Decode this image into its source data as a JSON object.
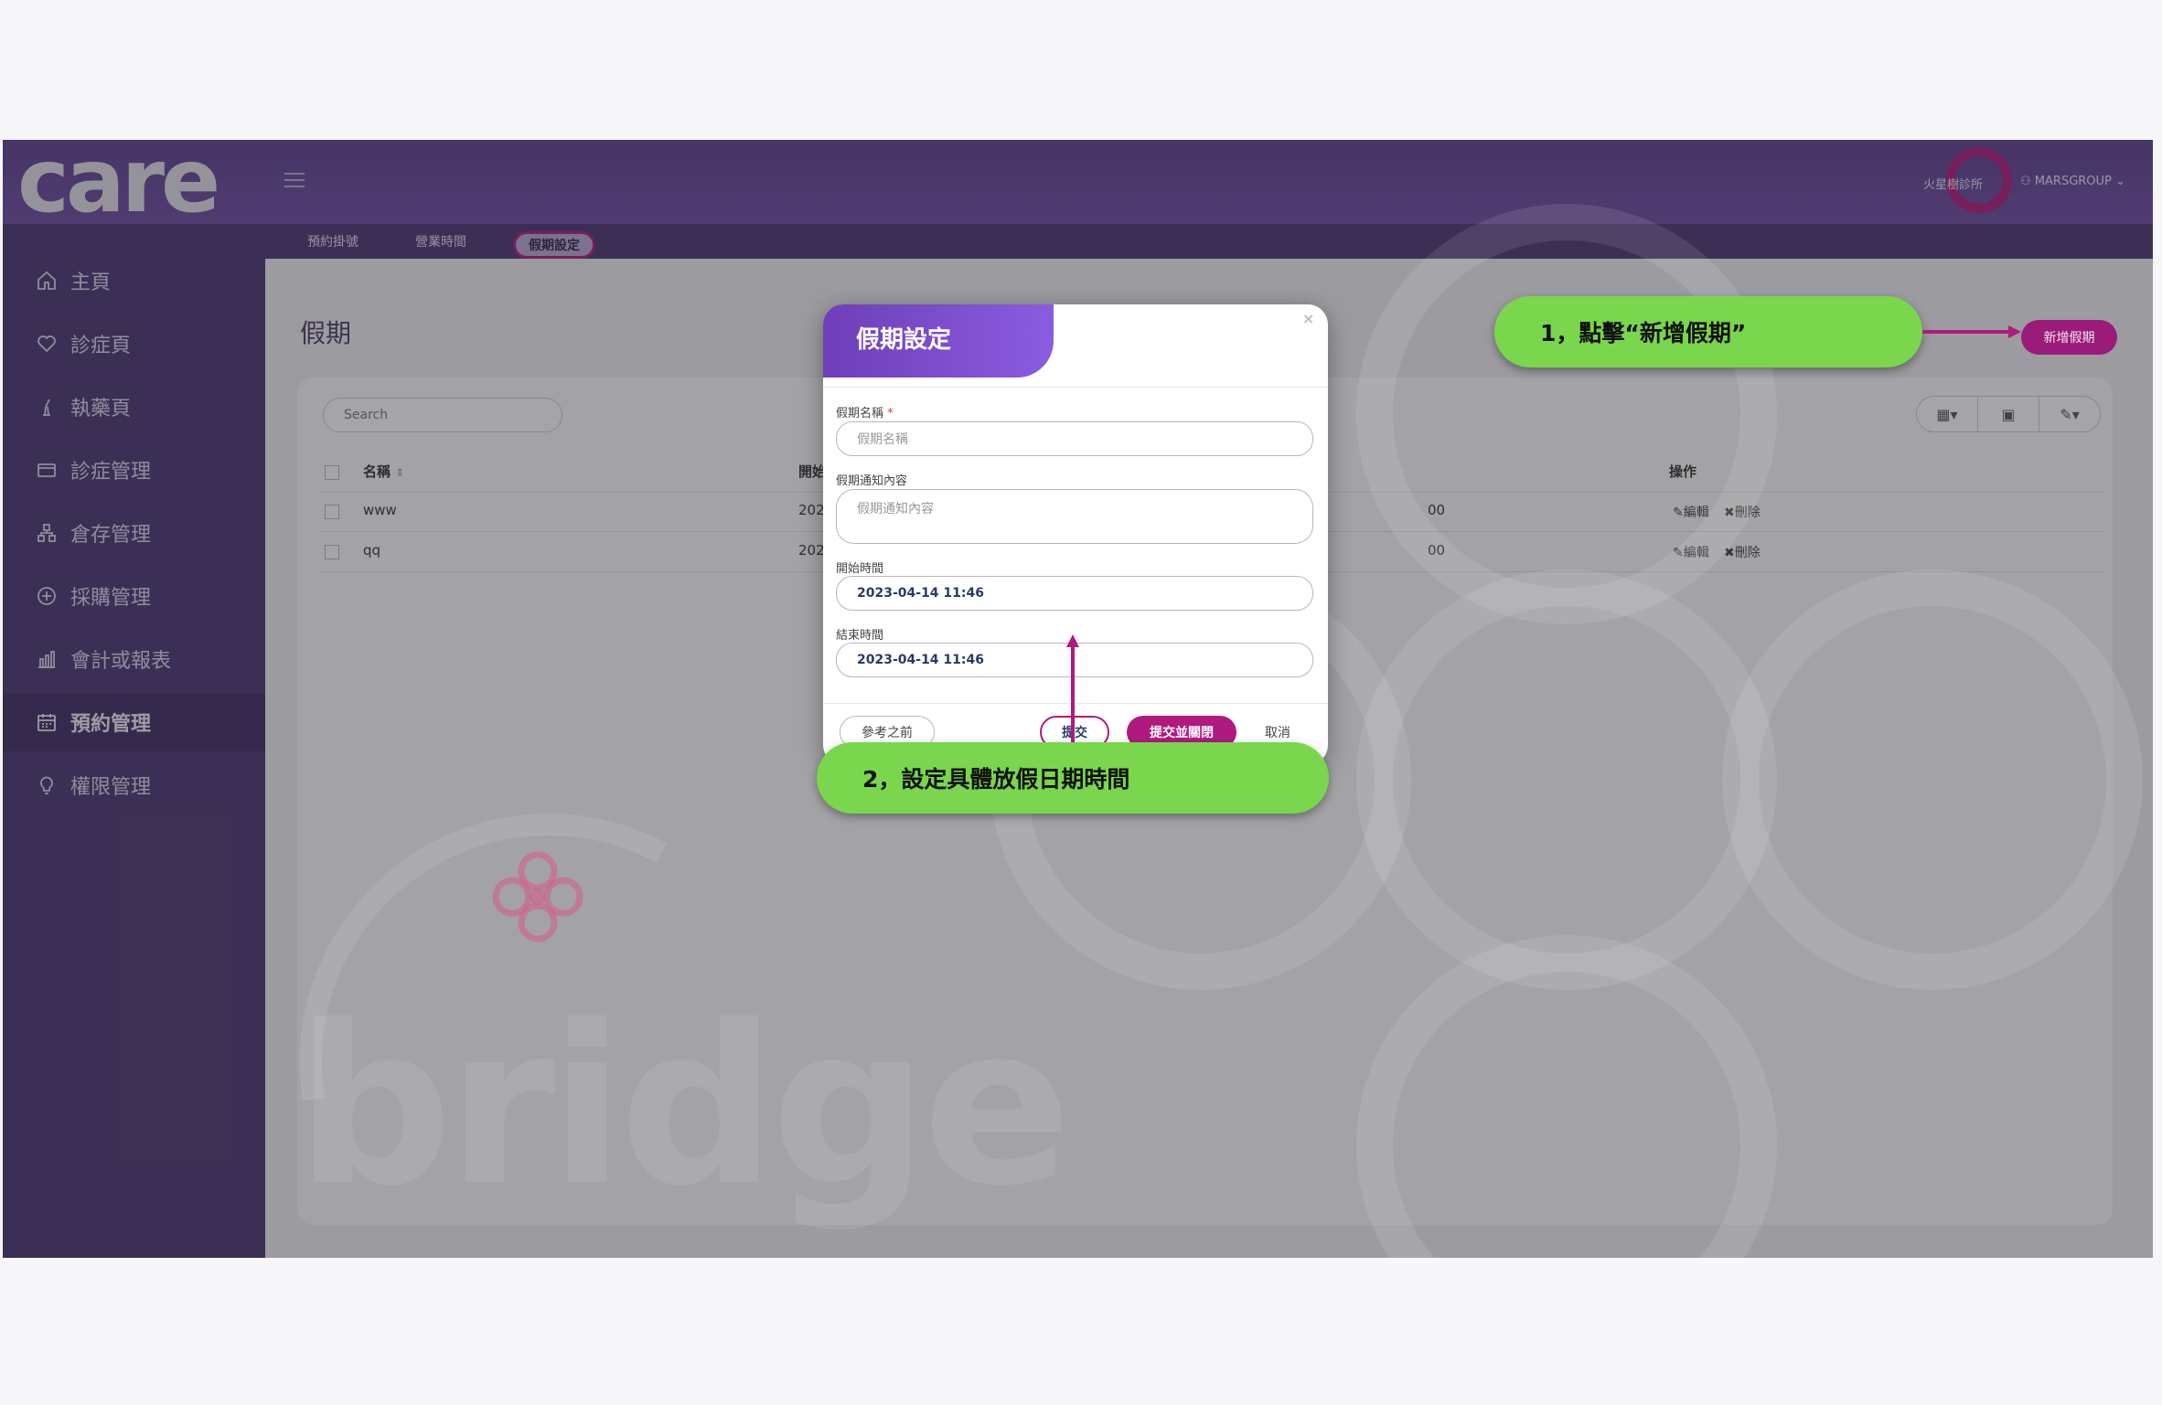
{
  "header": {
    "logo_text": "care",
    "clinic_name": "火星樹診所",
    "user_name": "MARSGROUP"
  },
  "tabs": [
    {
      "label": "預約掛號"
    },
    {
      "label": "營業時間"
    },
    {
      "label": "假期設定"
    }
  ],
  "sidebar": {
    "items": [
      {
        "label": "主頁",
        "icon": "home-icon"
      },
      {
        "label": "診症頁",
        "icon": "heart-icon"
      },
      {
        "label": "執藥頁",
        "icon": "mortar-icon"
      },
      {
        "label": "診症管理",
        "icon": "card-icon"
      },
      {
        "label": "倉存管理",
        "icon": "boxes-icon"
      },
      {
        "label": "採購管理",
        "icon": "plus-circle-icon"
      },
      {
        "label": "會計或報表",
        "icon": "bar-chart-icon"
      },
      {
        "label": "預約管理",
        "icon": "calendar-icon"
      },
      {
        "label": "權限管理",
        "icon": "lightbulb-icon"
      }
    ]
  },
  "page": {
    "title": "假期",
    "search_placeholder": "Search",
    "add_button": "新增假期"
  },
  "table": {
    "columns": [
      "名稱",
      "開始",
      "操作"
    ],
    "rows": [
      {
        "name": "www",
        "start": "202",
        "end_tail": "00",
        "edit": "編輯",
        "delete": "刪除"
      },
      {
        "name": "qq",
        "start": "202",
        "end_tail": "00",
        "edit": "編輯",
        "delete": "刪除"
      }
    ]
  },
  "dialog": {
    "title": "假期設定",
    "close": "×",
    "fields": {
      "name_label": "假期名稱",
      "required_mark": "*",
      "name_placeholder": "假期名稱",
      "notice_label": "假期通知內容",
      "notice_placeholder": "假期通知內容",
      "start_label": "開始時間",
      "start_value": "2023-04-14 11:46",
      "end_label": "結束時間",
      "end_value": "2023-04-14 11:46"
    },
    "buttons": {
      "previous": "參考之前",
      "submit": "提交",
      "submit_close": "提交並關閉",
      "cancel": "取消"
    }
  },
  "callouts": {
    "step1": "1，點擊“新增假期”",
    "step2": "2，設定具體放假日期時間"
  },
  "watermark_text": "bridge",
  "colors": {
    "brand_purple": "#5d3f90",
    "accent_magenta": "#b0197f",
    "callout_green": "#7ad64c"
  }
}
